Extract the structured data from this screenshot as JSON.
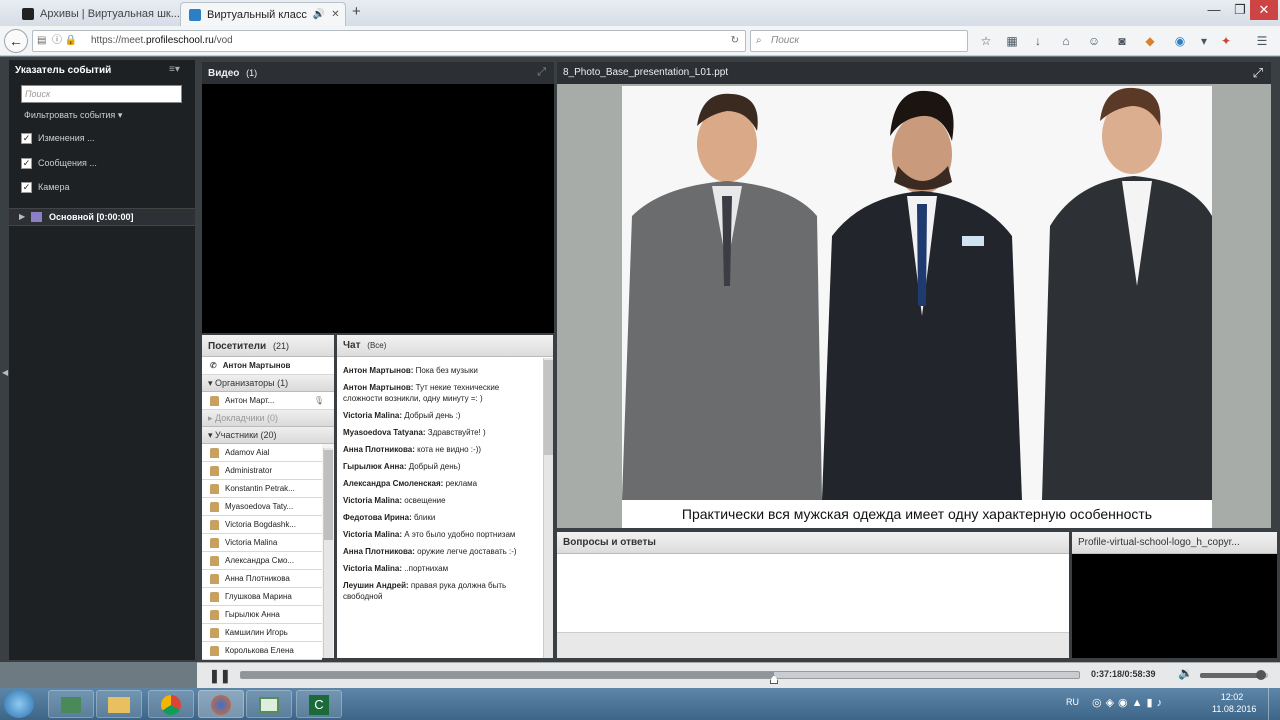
{
  "browser": {
    "tabs": [
      {
        "title": "Архивы | Виртуальная шк..."
      },
      {
        "title": "Виртуальный класс"
      }
    ],
    "new_tab": "+",
    "url_prefix": "https://meet.",
    "url_domain": "profileschool.ru",
    "url_path": "/vod",
    "search_placeholder": "Поиск"
  },
  "events_panel": {
    "title": "Указатель событий",
    "search_placeholder": "Поиск",
    "filter_label": "Фильтровать события",
    "filters": [
      {
        "label": "Изменения ...",
        "checked": true
      },
      {
        "label": "Сообщения ...",
        "checked": true
      },
      {
        "label": "Камера",
        "checked": true
      }
    ],
    "main_item": "Основной [0:00:00]"
  },
  "video": {
    "title": "Видео",
    "count": "(1)"
  },
  "visitors": {
    "title": "Посетители",
    "count": "(21)",
    "host": "Антон Мартынов",
    "organizers_group": "Организаторы (1)",
    "organizers": [
      "Антон Март..."
    ],
    "speakers_group": "Докладчики (0)",
    "participants_group": "Участники (20)",
    "participants": [
      "Adamov Aial",
      "Administrator",
      "Konstantin Petrak...",
      "Myasoedova Taty...",
      "Victoria Bogdashk...",
      "Victoria Malina",
      "Александра Смо...",
      "Анна Плотникова",
      "Глушкова Марина",
      "Гырылюк Анна",
      "Камшилин Игорь",
      "Королькова Елена"
    ]
  },
  "chat": {
    "title": "Чат",
    "scope": "(Все)",
    "messages": [
      {
        "author": "Антон Мартынов:",
        "text": " Пока без музыки"
      },
      {
        "author": "Антон Мартынов:",
        "text": " Тут некие технические сложности возникли, одну минуту =: )"
      },
      {
        "author": "Victoria Malina:",
        "text": " Добрый день :)"
      },
      {
        "author": "Myasoedova Tatyana:",
        "text": " Здравствуйте! )"
      },
      {
        "author": "Анна Плотникова:",
        "text": " кота не видно :-))"
      },
      {
        "author": "Гырылюк Анна:",
        "text": " Добрый день)"
      },
      {
        "author": "Александра Смоленская:",
        "text": " реклама"
      },
      {
        "author": "Victoria Malina:",
        "text": " освещение"
      },
      {
        "author": "Федотова Ирина:",
        "text": " блики"
      },
      {
        "author": "Victoria Malina:",
        "text": " А это было удобно портнизам"
      },
      {
        "author": "Анна Плотникова:",
        "text": " оружие легче доставать :-)"
      },
      {
        "author": "Victoria Malina:",
        "text": " ..портнихам"
      },
      {
        "author": "Леушин Андрей:",
        "text": " правая рука должна быть свободной"
      }
    ]
  },
  "presentation": {
    "filename": "8_Photo_Base_presentation_L01.ppt",
    "caption": "Практически вся мужская одежда имеет одну характерную особенность"
  },
  "qa": {
    "title": "Вопросы и ответы"
  },
  "logo_panel": {
    "title": "Profile-virtual-school-logo_h_copyr..."
  },
  "player": {
    "time": "0:37:18/0:58:39",
    "progress": 0.636,
    "volume": 0.9
  },
  "taskbar": {
    "lang": "RU",
    "clock_time": "12:02",
    "clock_date": "11.08.2016"
  }
}
